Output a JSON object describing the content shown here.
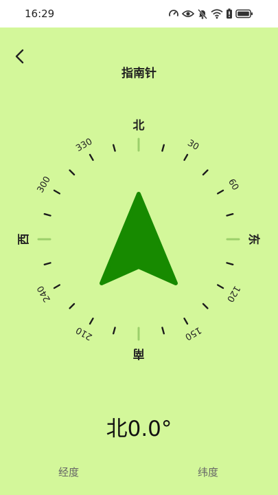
{
  "status_bar": {
    "time": "16:29",
    "icons": [
      "speed-icon",
      "eye-icon",
      "mute-icon",
      "wifi-icon",
      "battery-saver-icon",
      "battery-icon"
    ]
  },
  "header": {
    "title": "指南针"
  },
  "dial": {
    "cardinals": {
      "north": "北",
      "east": "东",
      "south": "南",
      "west": "西"
    },
    "degree_labels": [
      "30",
      "60",
      "120",
      "150",
      "210",
      "240",
      "300",
      "330"
    ],
    "heading_degrees": 0,
    "needle_color": "#178a00",
    "tick_color": "#1c1c1c",
    "cardinal_tick_color": "#9ccf6b"
  },
  "reading": {
    "text": "北0.0°"
  },
  "bottom": {
    "longitude_label": "经度",
    "latitude_label": "纬度"
  },
  "colors": {
    "background": "#d3f79a",
    "statusbar": "#ffffff"
  }
}
